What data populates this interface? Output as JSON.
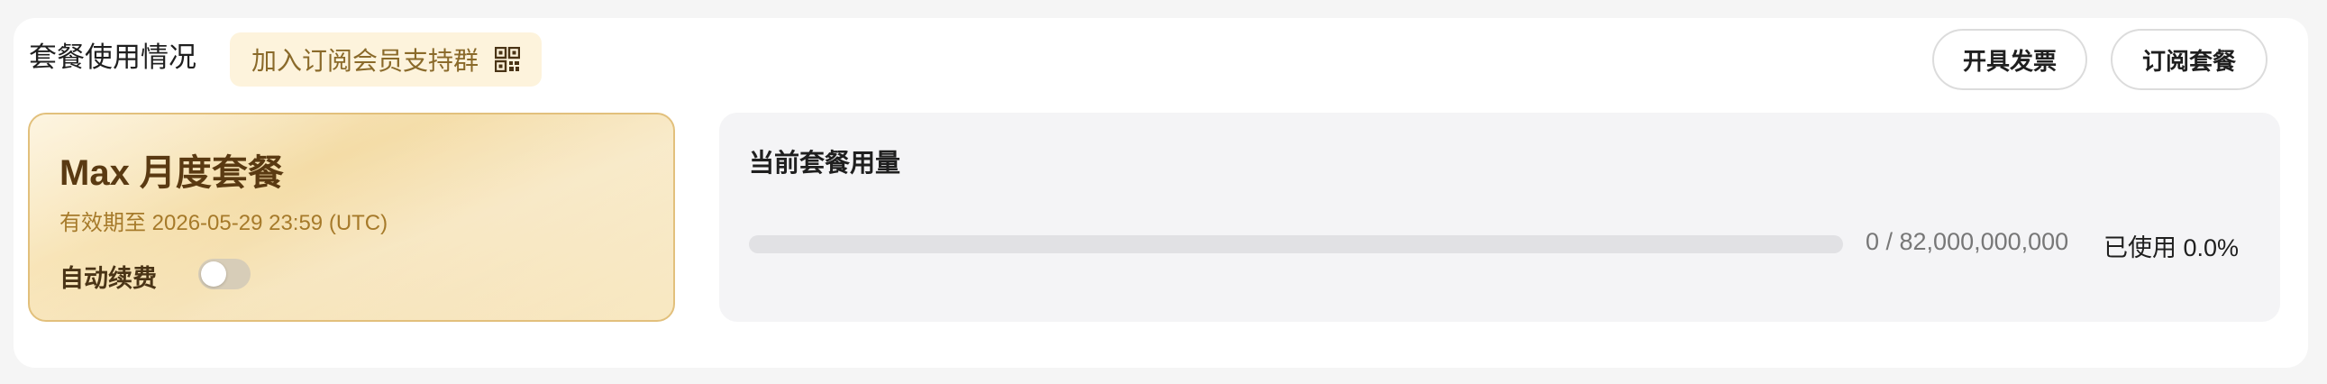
{
  "header": {
    "title": "套餐使用情况",
    "support_group_label": "加入订阅会员支持群",
    "support_group_icon": "qr-code-icon",
    "invoice_button": "开具发票",
    "subscribe_button": "订阅套餐"
  },
  "plan": {
    "name": "Max 月度套餐",
    "expiry": "有效期至 2026-05-29 23:59 (UTC)",
    "auto_renew_label": "自动续费",
    "auto_renew_enabled": false
  },
  "usage": {
    "title": "当前套餐用量",
    "count_text": "0 / 82,000,000,000",
    "used": 0,
    "total": 82000000000,
    "percent_text": "已使用 0.0%",
    "progress_fraction": 0.0
  },
  "colors": {
    "accent_gold": "#c9a35a",
    "plan_text": "#5a3a12",
    "badge_bg": "#fdf3dc"
  }
}
